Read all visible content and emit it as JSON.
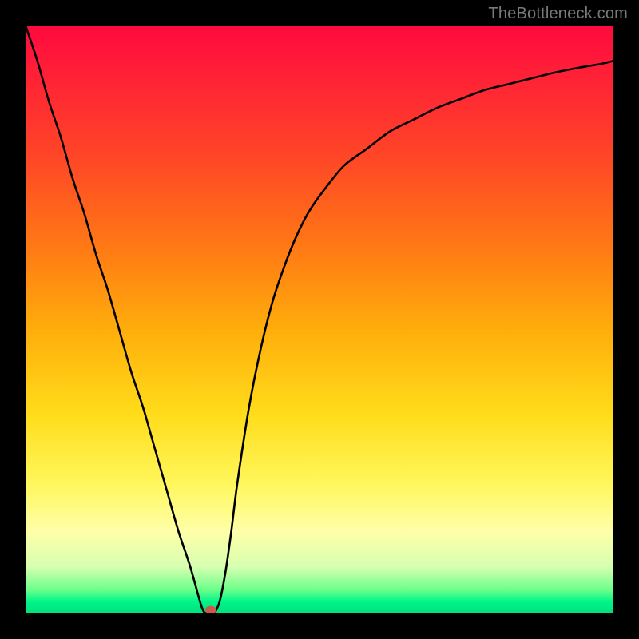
{
  "watermark": "TheBottleneck.com",
  "chart_data": {
    "type": "line",
    "title": "",
    "xlabel": "",
    "ylabel": "",
    "xlim": [
      0,
      100
    ],
    "ylim": [
      0,
      100
    ],
    "series": [
      {
        "name": "bottleneck-curve",
        "x": [
          0,
          2,
          4,
          6,
          8,
          10,
          12,
          14,
          16,
          18,
          20,
          22,
          24,
          26,
          28,
          30,
          31,
          32,
          33,
          34,
          35,
          36,
          38,
          40,
          42,
          44,
          46,
          48,
          50,
          54,
          58,
          62,
          66,
          70,
          74,
          78,
          82,
          86,
          90,
          94,
          98,
          100
        ],
        "y": [
          100,
          94,
          87,
          81,
          74,
          68,
          61,
          55,
          48,
          41,
          35,
          28,
          21,
          14,
          8,
          1,
          0,
          0,
          2,
          7,
          14,
          22,
          35,
          45,
          53,
          59,
          64,
          68,
          71,
          76,
          79,
          82,
          84,
          86,
          87.5,
          89,
          90,
          91,
          92,
          92.8,
          93.5,
          94
        ]
      }
    ],
    "marker": {
      "x": 31.5,
      "y": 0.6,
      "color": "#cc5a4a"
    },
    "gradient_background": {
      "top": "#ff0a3e",
      "mid1": "#ffae0b",
      "mid2": "#fff75c",
      "bottom": "#00e07e"
    }
  }
}
